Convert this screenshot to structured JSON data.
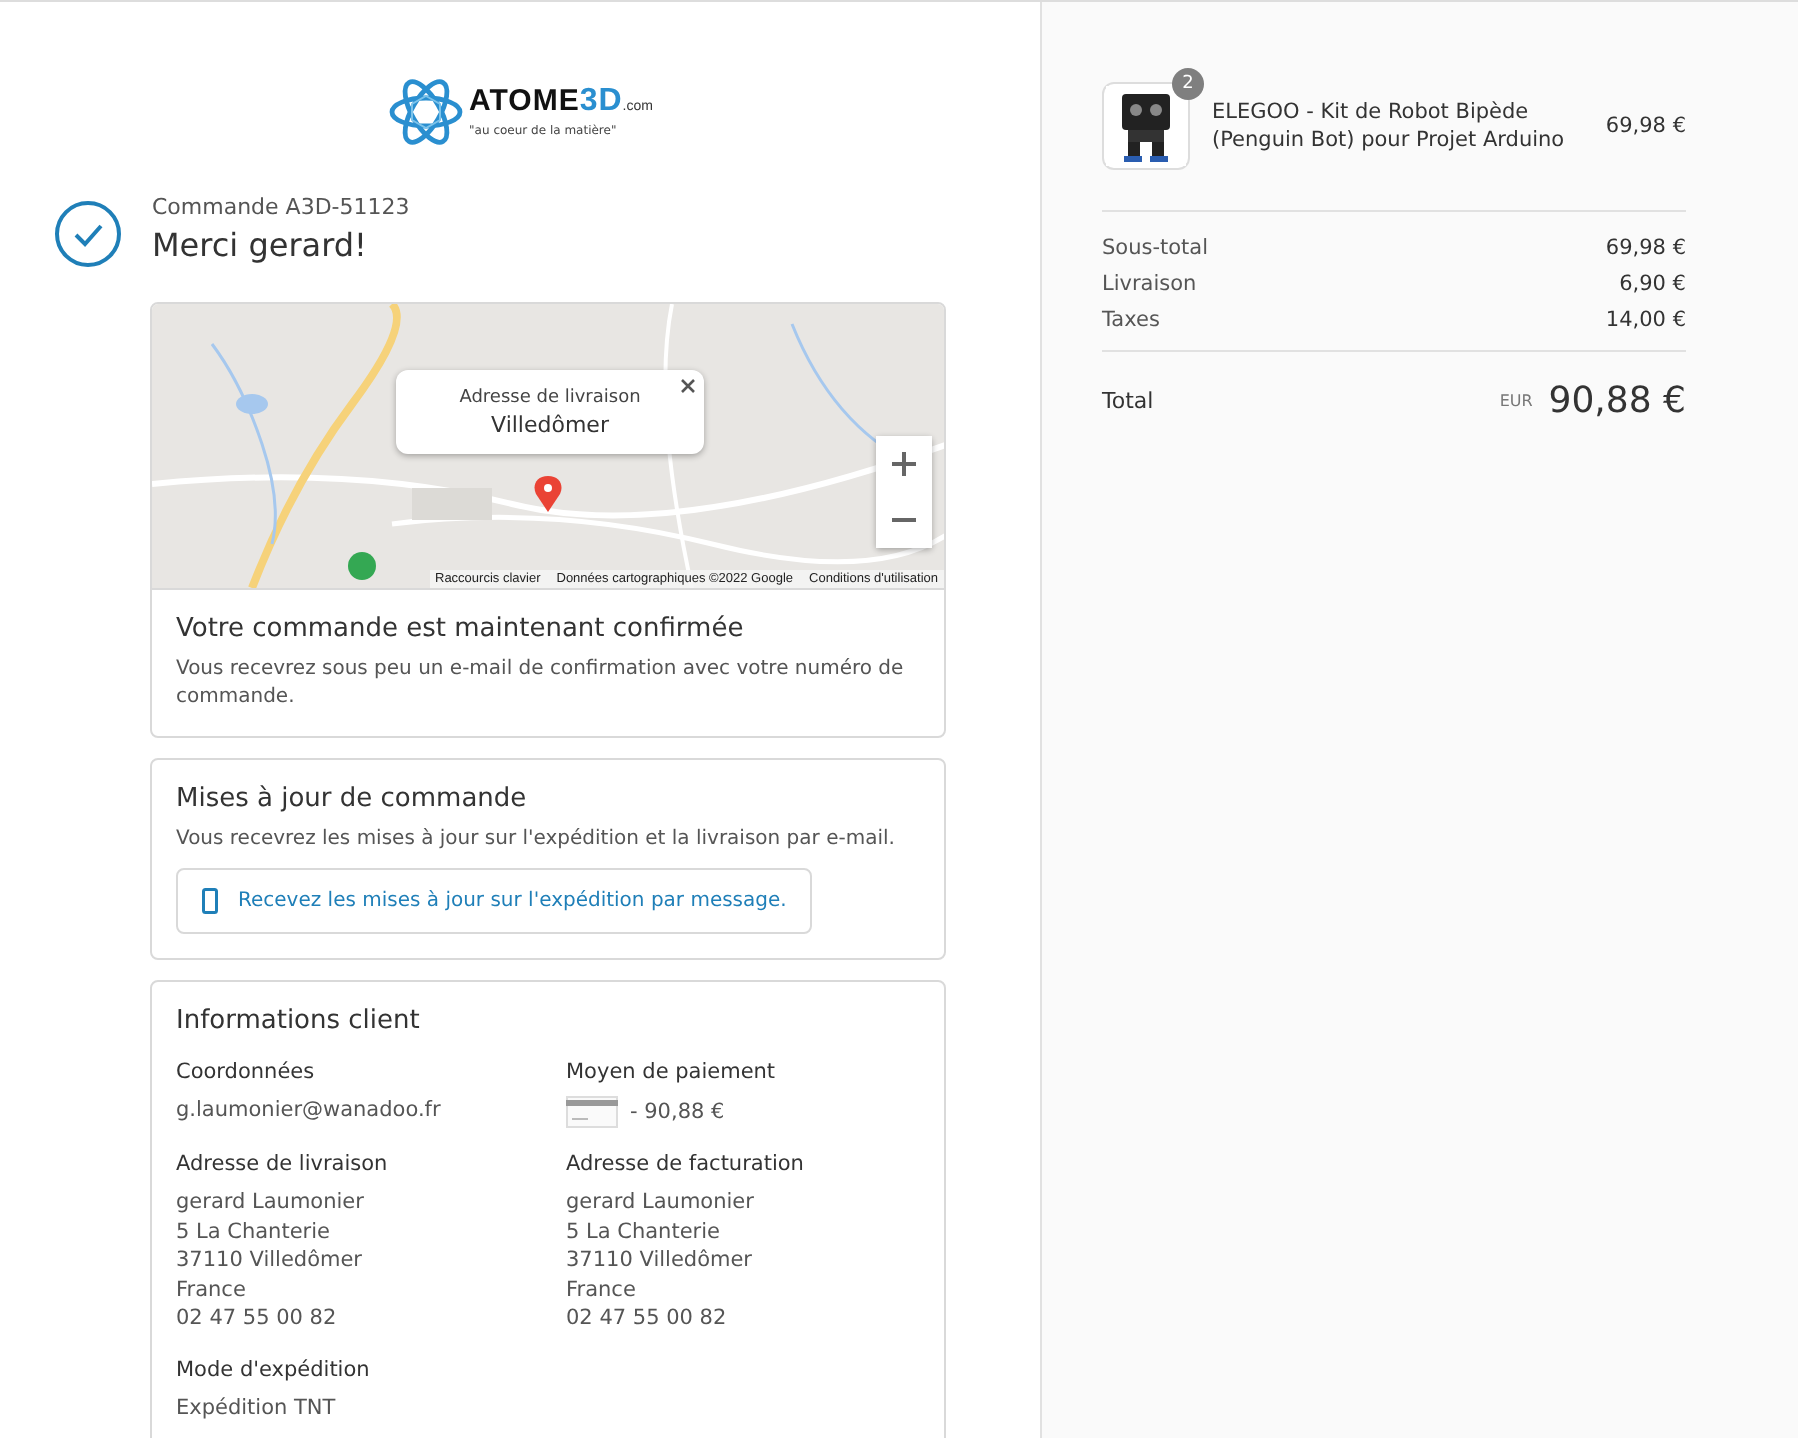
{
  "brand": {
    "name": "ATOME",
    "accent": "3D",
    "suffix": ".com",
    "tagline": "\"au coeur de la matière\""
  },
  "order": {
    "number": "Commande A3D-51123",
    "thanks": "Merci gerard!"
  },
  "map": {
    "popup": {
      "title": "Adresse de livraison",
      "place": "Villedômer"
    },
    "attribution": [
      "Raccourcis clavier",
      "Données cartographiques ©2022 Google",
      "Conditions d'utilisation"
    ]
  },
  "confirmation": {
    "title": "Votre commande est maintenant confirmée",
    "text": "Vous recevrez sous peu un e-mail de confirmation avec votre numéro de commande."
  },
  "updates": {
    "title": "Mises à jour de commande",
    "text": "Vous recevrez les mises à jour sur l'expédition et la livraison par e-mail.",
    "button": "Recevez les mises à jour sur l'expédition par message."
  },
  "customer": {
    "title": "Informations client",
    "sections": [
      {
        "heading": "Coordonnées",
        "lines": [
          "g.laumonier@wanadoo.fr"
        ]
      },
      {
        "heading": "Moyen de paiement",
        "kind": "payment",
        "lines": [
          "- 90,88 €"
        ]
      },
      {
        "heading": "Adresse de livraison",
        "lines": [
          "gerard Laumonier",
          "5 La Chanterie",
          "37110 Villedômer",
          "France",
          "02 47 55 00 82"
        ]
      },
      {
        "heading": "Adresse de facturation",
        "lines": [
          "gerard Laumonier",
          "5 La Chanterie",
          "37110 Villedômer",
          "France",
          "02 47 55 00 82"
        ]
      },
      {
        "heading": "Mode d'expédition",
        "lines": [
          "Expédition TNT"
        ]
      }
    ]
  },
  "cart": {
    "items": [
      {
        "quantity": "2",
        "name": "ELEGOO - Kit de Robot Bipède (Penguin Bot) pour Projet Arduino",
        "price": "69,98 €"
      }
    ],
    "summary": [
      {
        "label": "Sous-total",
        "value": "69,98 €"
      },
      {
        "label": "Livraison",
        "value": "6,90 €"
      },
      {
        "label": "Taxes",
        "value": "14,00 €"
      }
    ],
    "total": {
      "label": "Total",
      "currency": "EUR",
      "value": "90,88 €"
    }
  }
}
